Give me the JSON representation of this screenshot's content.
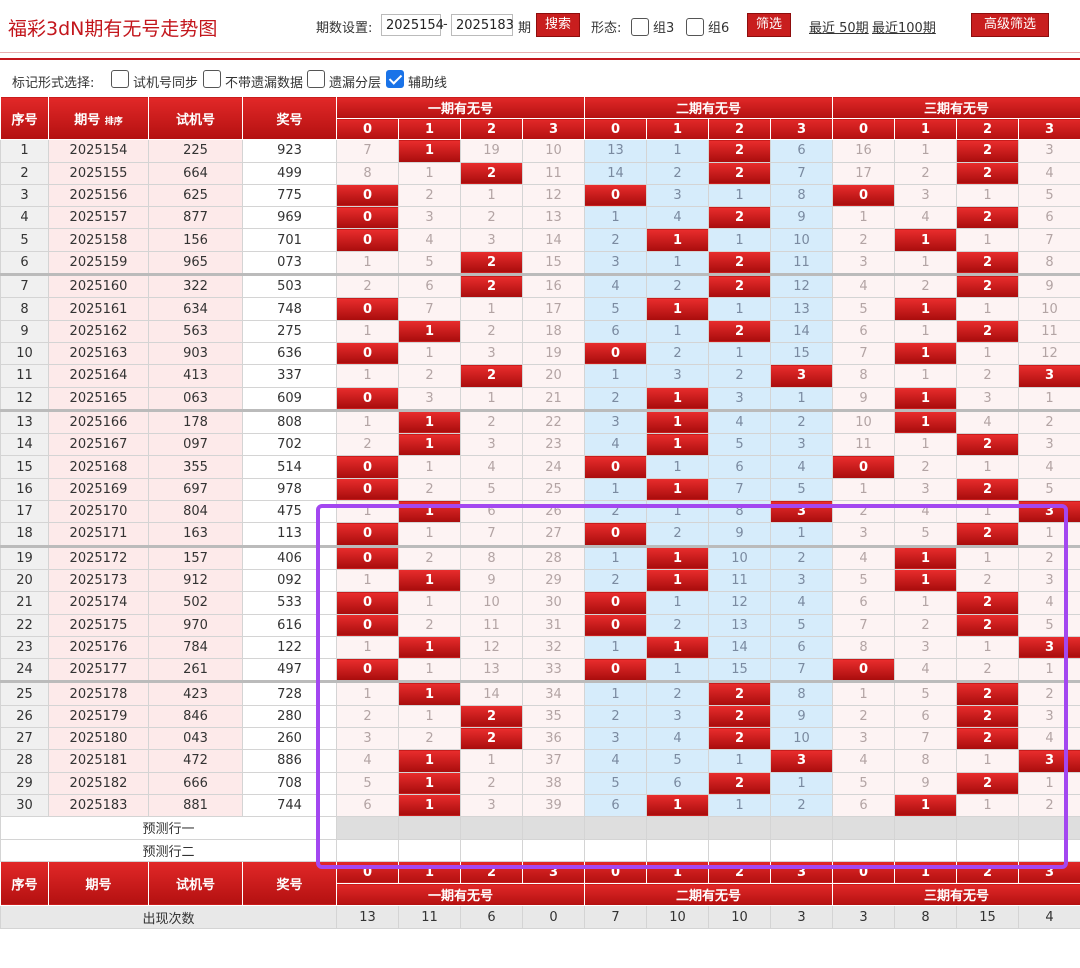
{
  "title": "福彩3dN期有无号走势图",
  "toolbar": {
    "period_label": "期数设置:",
    "period_from": "2025154",
    "period_to": "2025183",
    "period_suffix": "期",
    "search_btn": "搜索",
    "form_label": "形态:",
    "group3_label": "组3",
    "group6_label": "组6",
    "filter_btn": "筛选",
    "recent50": "最近 50期",
    "recent100": "最近100期",
    "advanced_btn": "高级筛选"
  },
  "options": {
    "label": "标记形式选择:",
    "opt1": "试机号同步",
    "opt2": "不带遗漏数据",
    "opt3": "遗漏分层",
    "opt4": "辅助线",
    "opt4_checked": true
  },
  "header": {
    "seq": "序号",
    "period": "期号",
    "sort": "排序",
    "trial": "试机号",
    "prize": "奖号",
    "group1": "一期有无号",
    "group2": "二期有无号",
    "group3": "三期有无号",
    "digits": [
      "0",
      "1",
      "2",
      "3"
    ]
  },
  "rows": [
    {
      "seq": "1",
      "period": "2025154",
      "trial": "225",
      "prize": "923",
      "g1": [
        "7",
        "1",
        "19",
        "10"
      ],
      "h1": [
        0,
        1,
        0,
        0
      ],
      "g2": [
        "13",
        "1",
        "2",
        "6"
      ],
      "h2": [
        0,
        0,
        1,
        0
      ],
      "g3": [
        "16",
        "1",
        "2",
        "3"
      ],
      "h3": [
        0,
        0,
        1,
        0
      ]
    },
    {
      "seq": "2",
      "period": "2025155",
      "trial": "664",
      "prize": "499",
      "g1": [
        "8",
        "1",
        "2",
        "11"
      ],
      "h1": [
        0,
        0,
        1,
        0
      ],
      "g2": [
        "14",
        "2",
        "2",
        "7"
      ],
      "h2": [
        0,
        0,
        1,
        0
      ],
      "g3": [
        "17",
        "2",
        "2",
        "4"
      ],
      "h3": [
        0,
        0,
        1,
        0
      ]
    },
    {
      "seq": "3",
      "period": "2025156",
      "trial": "625",
      "prize": "775",
      "g1": [
        "0",
        "2",
        "1",
        "12"
      ],
      "h1": [
        1,
        0,
        0,
        0
      ],
      "g2": [
        "0",
        "3",
        "1",
        "8"
      ],
      "h2": [
        1,
        0,
        0,
        0
      ],
      "g3": [
        "0",
        "3",
        "1",
        "5"
      ],
      "h3": [
        1,
        0,
        0,
        0
      ]
    },
    {
      "seq": "4",
      "period": "2025157",
      "trial": "877",
      "prize": "969",
      "g1": [
        "0",
        "3",
        "2",
        "13"
      ],
      "h1": [
        1,
        0,
        0,
        0
      ],
      "g2": [
        "1",
        "4",
        "2",
        "9"
      ],
      "h2": [
        0,
        0,
        1,
        0
      ],
      "g3": [
        "1",
        "4",
        "2",
        "6"
      ],
      "h3": [
        0,
        0,
        1,
        0
      ]
    },
    {
      "seq": "5",
      "period": "2025158",
      "trial": "156",
      "prize": "701",
      "g1": [
        "0",
        "4",
        "3",
        "14"
      ],
      "h1": [
        1,
        0,
        0,
        0
      ],
      "g2": [
        "2",
        "1",
        "1",
        "10"
      ],
      "h2": [
        0,
        1,
        0,
        0
      ],
      "g3": [
        "2",
        "1",
        "1",
        "7"
      ],
      "h3": [
        0,
        1,
        0,
        0
      ]
    },
    {
      "seq": "6",
      "period": "2025159",
      "trial": "965",
      "prize": "073",
      "g1": [
        "1",
        "5",
        "2",
        "15"
      ],
      "h1": [
        0,
        0,
        1,
        0
      ],
      "g2": [
        "3",
        "1",
        "2",
        "11"
      ],
      "h2": [
        0,
        0,
        1,
        0
      ],
      "g3": [
        "3",
        "1",
        "2",
        "8"
      ],
      "h3": [
        0,
        0,
        1,
        0
      ]
    },
    {
      "seq": "7",
      "period": "2025160",
      "trial": "322",
      "prize": "503",
      "g1": [
        "2",
        "6",
        "2",
        "16"
      ],
      "h1": [
        0,
        0,
        1,
        0
      ],
      "g2": [
        "4",
        "2",
        "2",
        "12"
      ],
      "h2": [
        0,
        0,
        1,
        0
      ],
      "g3": [
        "4",
        "2",
        "2",
        "9"
      ],
      "h3": [
        0,
        0,
        1,
        0
      ]
    },
    {
      "seq": "8",
      "period": "2025161",
      "trial": "634",
      "prize": "748",
      "g1": [
        "0",
        "7",
        "1",
        "17"
      ],
      "h1": [
        1,
        0,
        0,
        0
      ],
      "g2": [
        "5",
        "1",
        "1",
        "13"
      ],
      "h2": [
        0,
        1,
        0,
        0
      ],
      "g3": [
        "5",
        "1",
        "1",
        "10"
      ],
      "h3": [
        0,
        1,
        0,
        0
      ]
    },
    {
      "seq": "9",
      "period": "2025162",
      "trial": "563",
      "prize": "275",
      "g1": [
        "1",
        "1",
        "2",
        "18"
      ],
      "h1": [
        0,
        1,
        0,
        0
      ],
      "g2": [
        "6",
        "1",
        "2",
        "14"
      ],
      "h2": [
        0,
        0,
        1,
        0
      ],
      "g3": [
        "6",
        "1",
        "2",
        "11"
      ],
      "h3": [
        0,
        0,
        1,
        0
      ]
    },
    {
      "seq": "10",
      "period": "2025163",
      "trial": "903",
      "prize": "636",
      "g1": [
        "0",
        "1",
        "3",
        "19"
      ],
      "h1": [
        1,
        0,
        0,
        0
      ],
      "g2": [
        "0",
        "2",
        "1",
        "15"
      ],
      "h2": [
        1,
        0,
        0,
        0
      ],
      "g3": [
        "7",
        "1",
        "1",
        "12"
      ],
      "h3": [
        0,
        1,
        0,
        0
      ]
    },
    {
      "seq": "11",
      "period": "2025164",
      "trial": "413",
      "prize": "337",
      "g1": [
        "1",
        "2",
        "2",
        "20"
      ],
      "h1": [
        0,
        0,
        1,
        0
      ],
      "g2": [
        "1",
        "3",
        "2",
        "3"
      ],
      "h2": [
        0,
        0,
        0,
        1
      ],
      "g3": [
        "8",
        "1",
        "2",
        "3"
      ],
      "h3": [
        0,
        0,
        0,
        1
      ]
    },
    {
      "seq": "12",
      "period": "2025165",
      "trial": "063",
      "prize": "609",
      "g1": [
        "0",
        "3",
        "1",
        "21"
      ],
      "h1": [
        1,
        0,
        0,
        0
      ],
      "g2": [
        "2",
        "1",
        "3",
        "1"
      ],
      "h2": [
        0,
        1,
        0,
        0
      ],
      "g3": [
        "9",
        "1",
        "3",
        "1"
      ],
      "h3": [
        0,
        1,
        0,
        0
      ]
    },
    {
      "seq": "13",
      "period": "2025166",
      "trial": "178",
      "prize": "808",
      "g1": [
        "1",
        "1",
        "2",
        "22"
      ],
      "h1": [
        0,
        1,
        0,
        0
      ],
      "g2": [
        "3",
        "1",
        "4",
        "2"
      ],
      "h2": [
        0,
        1,
        0,
        0
      ],
      "g3": [
        "10",
        "1",
        "4",
        "2"
      ],
      "h3": [
        0,
        1,
        0,
        0
      ]
    },
    {
      "seq": "14",
      "period": "2025167",
      "trial": "097",
      "prize": "702",
      "g1": [
        "2",
        "1",
        "3",
        "23"
      ],
      "h1": [
        0,
        1,
        0,
        0
      ],
      "g2": [
        "4",
        "1",
        "5",
        "3"
      ],
      "h2": [
        0,
        1,
        0,
        0
      ],
      "g3": [
        "11",
        "1",
        "2",
        "3"
      ],
      "h3": [
        0,
        0,
        1,
        0
      ]
    },
    {
      "seq": "15",
      "period": "2025168",
      "trial": "355",
      "prize": "514",
      "g1": [
        "0",
        "1",
        "4",
        "24"
      ],
      "h1": [
        1,
        0,
        0,
        0
      ],
      "g2": [
        "0",
        "1",
        "6",
        "4"
      ],
      "h2": [
        1,
        0,
        0,
        0
      ],
      "g3": [
        "0",
        "2",
        "1",
        "4"
      ],
      "h3": [
        1,
        0,
        0,
        0
      ]
    },
    {
      "seq": "16",
      "period": "2025169",
      "trial": "697",
      "prize": "978",
      "g1": [
        "0",
        "2",
        "5",
        "25"
      ],
      "h1": [
        1,
        0,
        0,
        0
      ],
      "g2": [
        "1",
        "1",
        "7",
        "5"
      ],
      "h2": [
        0,
        1,
        0,
        0
      ],
      "g3": [
        "1",
        "3",
        "2",
        "5"
      ],
      "h3": [
        0,
        0,
        1,
        0
      ]
    },
    {
      "seq": "17",
      "period": "2025170",
      "trial": "804",
      "prize": "475",
      "g1": [
        "1",
        "1",
        "6",
        "26"
      ],
      "h1": [
        0,
        1,
        0,
        0
      ],
      "g2": [
        "2",
        "1",
        "8",
        "3"
      ],
      "h2": [
        0,
        0,
        0,
        1
      ],
      "g3": [
        "2",
        "4",
        "1",
        "3"
      ],
      "h3": [
        0,
        0,
        0,
        1
      ]
    },
    {
      "seq": "18",
      "period": "2025171",
      "trial": "163",
      "prize": "113",
      "g1": [
        "0",
        "1",
        "7",
        "27"
      ],
      "h1": [
        1,
        0,
        0,
        0
      ],
      "g2": [
        "0",
        "2",
        "9",
        "1"
      ],
      "h2": [
        1,
        0,
        0,
        0
      ],
      "g3": [
        "3",
        "5",
        "2",
        "1"
      ],
      "h3": [
        0,
        0,
        1,
        0
      ]
    },
    {
      "seq": "19",
      "period": "2025172",
      "trial": "157",
      "prize": "406",
      "g1": [
        "0",
        "2",
        "8",
        "28"
      ],
      "h1": [
        1,
        0,
        0,
        0
      ],
      "g2": [
        "1",
        "1",
        "10",
        "2"
      ],
      "h2": [
        0,
        1,
        0,
        0
      ],
      "g3": [
        "4",
        "1",
        "1",
        "2"
      ],
      "h3": [
        0,
        1,
        0,
        0
      ]
    },
    {
      "seq": "20",
      "period": "2025173",
      "trial": "912",
      "prize": "092",
      "g1": [
        "1",
        "1",
        "9",
        "29"
      ],
      "h1": [
        0,
        1,
        0,
        0
      ],
      "g2": [
        "2",
        "1",
        "11",
        "3"
      ],
      "h2": [
        0,
        1,
        0,
        0
      ],
      "g3": [
        "5",
        "1",
        "2",
        "3"
      ],
      "h3": [
        0,
        1,
        0,
        0
      ]
    },
    {
      "seq": "21",
      "period": "2025174",
      "trial": "502",
      "prize": "533",
      "g1": [
        "0",
        "1",
        "10",
        "30"
      ],
      "h1": [
        1,
        0,
        0,
        0
      ],
      "g2": [
        "0",
        "1",
        "12",
        "4"
      ],
      "h2": [
        1,
        0,
        0,
        0
      ],
      "g3": [
        "6",
        "1",
        "2",
        "4"
      ],
      "h3": [
        0,
        0,
        1,
        0
      ]
    },
    {
      "seq": "22",
      "period": "2025175",
      "trial": "970",
      "prize": "616",
      "g1": [
        "0",
        "2",
        "11",
        "31"
      ],
      "h1": [
        1,
        0,
        0,
        0
      ],
      "g2": [
        "0",
        "2",
        "13",
        "5"
      ],
      "h2": [
        1,
        0,
        0,
        0
      ],
      "g3": [
        "7",
        "2",
        "2",
        "5"
      ],
      "h3": [
        0,
        0,
        1,
        0
      ]
    },
    {
      "seq": "23",
      "period": "2025176",
      "trial": "784",
      "prize": "122",
      "g1": [
        "1",
        "1",
        "12",
        "32"
      ],
      "h1": [
        0,
        1,
        0,
        0
      ],
      "g2": [
        "1",
        "1",
        "14",
        "6"
      ],
      "h2": [
        0,
        1,
        0,
        0
      ],
      "g3": [
        "8",
        "3",
        "1",
        "3"
      ],
      "h3": [
        0,
        0,
        0,
        1
      ]
    },
    {
      "seq": "24",
      "period": "2025177",
      "trial": "261",
      "prize": "497",
      "g1": [
        "0",
        "1",
        "13",
        "33"
      ],
      "h1": [
        1,
        0,
        0,
        0
      ],
      "g2": [
        "0",
        "1",
        "15",
        "7"
      ],
      "h2": [
        1,
        0,
        0,
        0
      ],
      "g3": [
        "0",
        "4",
        "2",
        "1"
      ],
      "h3": [
        1,
        0,
        0,
        0
      ]
    },
    {
      "seq": "25",
      "period": "2025178",
      "trial": "423",
      "prize": "728",
      "g1": [
        "1",
        "1",
        "14",
        "34"
      ],
      "h1": [
        0,
        1,
        0,
        0
      ],
      "g2": [
        "1",
        "2",
        "2",
        "8"
      ],
      "h2": [
        0,
        0,
        1,
        0
      ],
      "g3": [
        "1",
        "5",
        "2",
        "2"
      ],
      "h3": [
        0,
        0,
        1,
        0
      ]
    },
    {
      "seq": "26",
      "period": "2025179",
      "trial": "846",
      "prize": "280",
      "g1": [
        "2",
        "1",
        "2",
        "35"
      ],
      "h1": [
        0,
        0,
        1,
        0
      ],
      "g2": [
        "2",
        "3",
        "2",
        "9"
      ],
      "h2": [
        0,
        0,
        1,
        0
      ],
      "g3": [
        "2",
        "6",
        "2",
        "3"
      ],
      "h3": [
        0,
        0,
        1,
        0
      ]
    },
    {
      "seq": "27",
      "period": "2025180",
      "trial": "043",
      "prize": "260",
      "g1": [
        "3",
        "2",
        "2",
        "36"
      ],
      "h1": [
        0,
        0,
        1,
        0
      ],
      "g2": [
        "3",
        "4",
        "2",
        "10"
      ],
      "h2": [
        0,
        0,
        1,
        0
      ],
      "g3": [
        "3",
        "7",
        "2",
        "4"
      ],
      "h3": [
        0,
        0,
        1,
        0
      ]
    },
    {
      "seq": "28",
      "period": "2025181",
      "trial": "472",
      "prize": "886",
      "g1": [
        "4",
        "1",
        "1",
        "37"
      ],
      "h1": [
        0,
        1,
        0,
        0
      ],
      "g2": [
        "4",
        "5",
        "1",
        "3"
      ],
      "h2": [
        0,
        0,
        0,
        1
      ],
      "g3": [
        "4",
        "8",
        "1",
        "3"
      ],
      "h3": [
        0,
        0,
        0,
        1
      ]
    },
    {
      "seq": "29",
      "period": "2025182",
      "trial": "666",
      "prize": "708",
      "g1": [
        "5",
        "1",
        "2",
        "38"
      ],
      "h1": [
        0,
        1,
        0,
        0
      ],
      "g2": [
        "5",
        "6",
        "2",
        "1"
      ],
      "h2": [
        0,
        0,
        1,
        0
      ],
      "g3": [
        "5",
        "9",
        "2",
        "1"
      ],
      "h3": [
        0,
        0,
        1,
        0
      ]
    },
    {
      "seq": "30",
      "period": "2025183",
      "trial": "881",
      "prize": "744",
      "g1": [
        "6",
        "1",
        "3",
        "39"
      ],
      "h1": [
        0,
        1,
        0,
        0
      ],
      "g2": [
        "6",
        "1",
        "1",
        "2"
      ],
      "h2": [
        0,
        1,
        0,
        0
      ],
      "g3": [
        "6",
        "1",
        "1",
        "2"
      ],
      "h3": [
        0,
        1,
        0,
        0
      ]
    }
  ],
  "predict1": "预测行一",
  "predict2": "预测行二",
  "footer": {
    "seq": "序号",
    "period": "期号",
    "trial": "试机号",
    "prize": "奖号",
    "occur_label": "出现次数",
    "occur": [
      "13",
      "11",
      "6",
      "0",
      "7",
      "10",
      "10",
      "3",
      "3",
      "8",
      "15",
      "4"
    ]
  },
  "colors": {
    "accent": "#c3161c",
    "blue_band": "#d6ecfb",
    "pink_band": "#fdf3f3",
    "highlight": "#a347f0"
  }
}
